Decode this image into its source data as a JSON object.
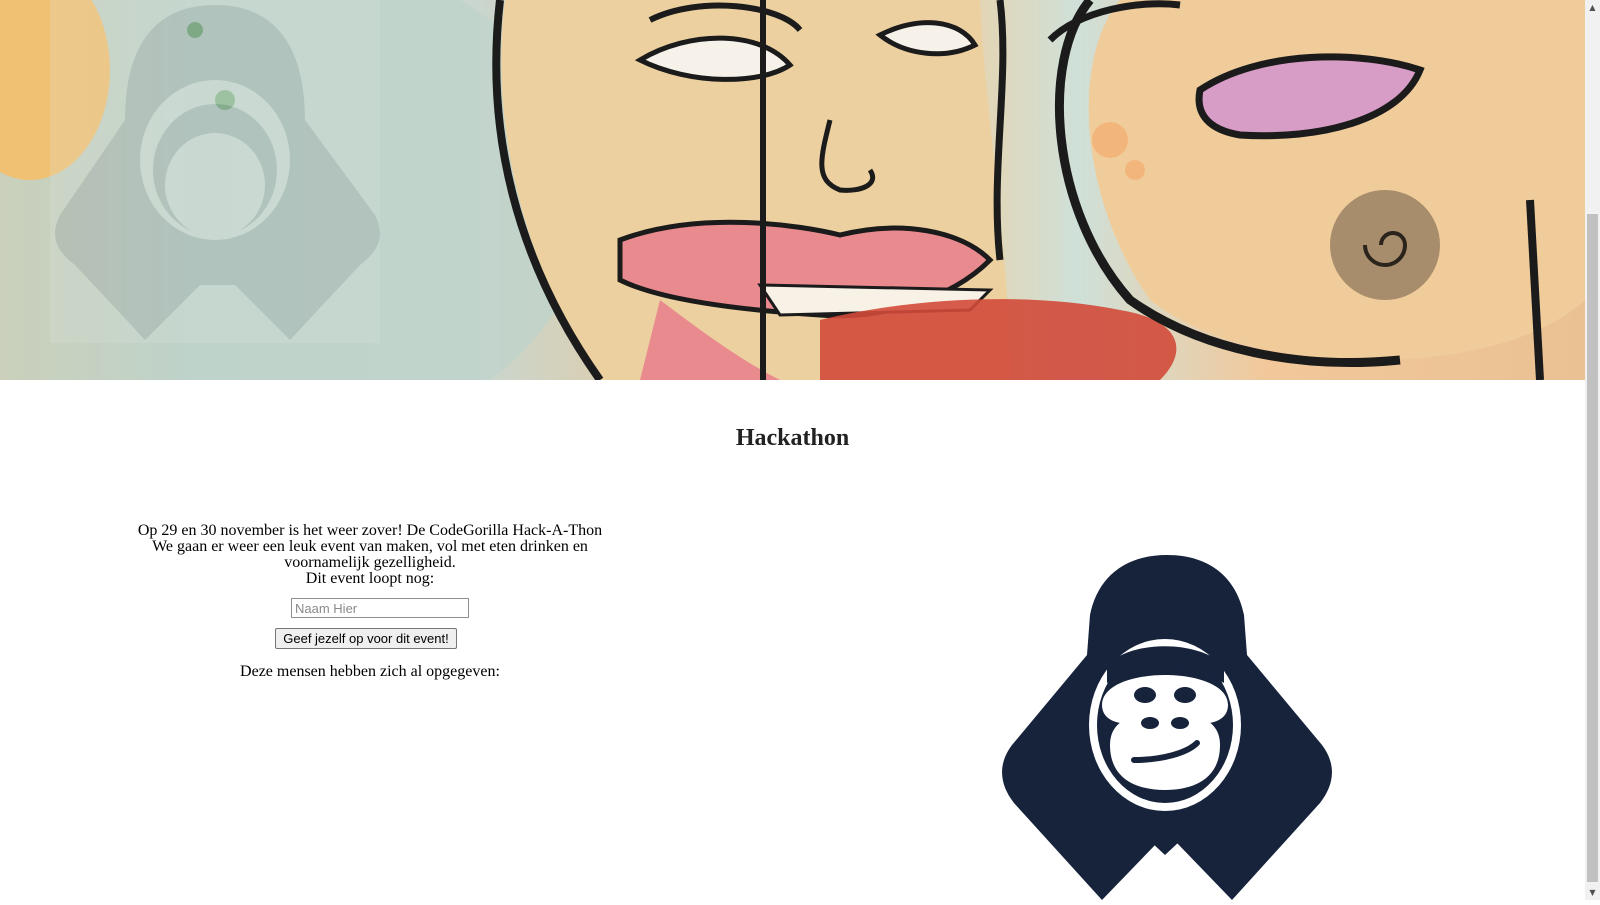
{
  "banner": {
    "alt": "Graffiti banner with CodeGorilla logo"
  },
  "main": {
    "title": "Hackathon",
    "description_line1": "Op 29 en 30 november is het weer zover! De CodeGorilla Hack-A-Thon",
    "description_line2": "We gaan er weer een leuk event van maken, vol met eten drinken en voornamelijk gezelligheid.",
    "countdown_label": "Dit event loopt nog:",
    "name_placeholder": "Naam Hier",
    "name_value": "",
    "submit_label": "Geef jezelf op voor dit event!",
    "signed_up_label": "Deze mensen hebben zich al opgegeven:"
  },
  "colors": {
    "logo": "#16233b",
    "text": "#000000",
    "title": "#222222"
  },
  "icons": {
    "scroll_up": "▲",
    "scroll_down": "▼"
  }
}
